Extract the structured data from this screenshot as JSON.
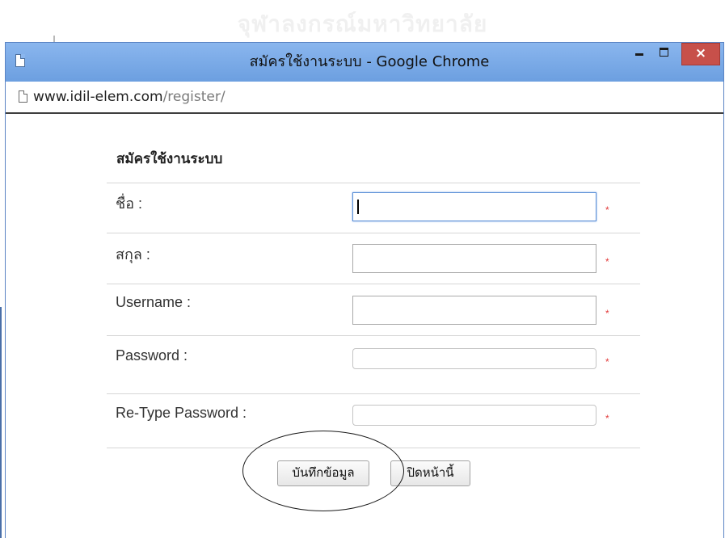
{
  "background": {
    "watermark_text": "จุฬาลงกรณ์มหาวิทยาลัย"
  },
  "window": {
    "title": "สมัครใช้งานระบบ - Google Chrome",
    "close_glyph": "×",
    "accent_color": "#6ea0e0",
    "close_color": "#c7504a"
  },
  "address_bar": {
    "host": "www.idil-elem.com",
    "path": "/register/"
  },
  "form": {
    "title": "สมัครใช้งานระบบ",
    "required_marker": "*",
    "fields": [
      {
        "label": "ชื่อ :",
        "value": "",
        "state": "focused"
      },
      {
        "label": "สกุล :",
        "value": ""
      },
      {
        "label": "Username :",
        "value": ""
      },
      {
        "label": "Password :",
        "value": ""
      },
      {
        "label": "Re-Type Password :",
        "value": ""
      }
    ],
    "buttons": {
      "save": "บันทึกข้อมูล",
      "close_page": "ปิดหน้านี้"
    }
  },
  "icons": [
    "page-icon",
    "minimize-icon",
    "maximize-icon",
    "close-icon"
  ]
}
